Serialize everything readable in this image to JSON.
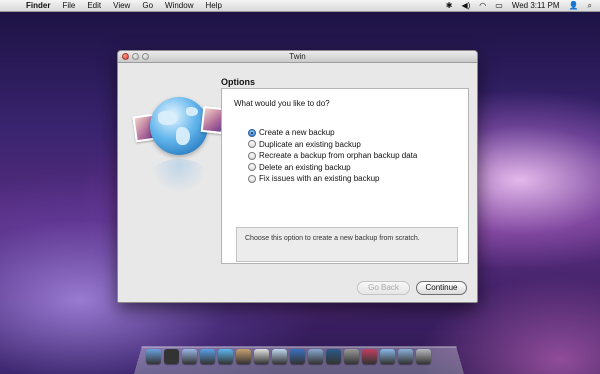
{
  "menubar": {
    "app": "Finder",
    "items": [
      "File",
      "Edit",
      "View",
      "Go",
      "Window",
      "Help"
    ],
    "clock": "Wed 3:11 PM"
  },
  "window": {
    "title": "Twin",
    "heading": "Options",
    "question": "What would you like to do?",
    "options": [
      "Create a new backup",
      "Duplicate an existing backup",
      "Recreate a backup from orphan backup data",
      "Delete an existing backup",
      "Fix issues with an existing backup"
    ],
    "selected_option": "Create a new backup",
    "description": "Choose this option to create a new backup from scratch.",
    "back_label": "Go Back",
    "continue_label": "Continue"
  },
  "dock": {
    "icons": [
      "finder-icon",
      "dashboard-icon",
      "mail-icon",
      "safari-icon",
      "ichat-icon",
      "addressbook-icon",
      "ical-icon",
      "preview-icon",
      "itunes-icon",
      "iphoto-icon",
      "timemachine-icon",
      "systemprefs-icon",
      "app-icon",
      "folder-icon",
      "downloads-icon",
      "trash-icon"
    ],
    "colors": [
      "#6aa0e0",
      "#333333",
      "#9ab8e8",
      "#5aa0e8",
      "#5ab8f0",
      "#c8a070",
      "#e0e0e0",
      "#c0d8f0",
      "#3a70c0",
      "#88a8d0",
      "#2a5a8a",
      "#9a9a9a",
      "#c04060",
      "#8ab8e8",
      "#8ab0d8",
      "#b8b8c0"
    ]
  }
}
